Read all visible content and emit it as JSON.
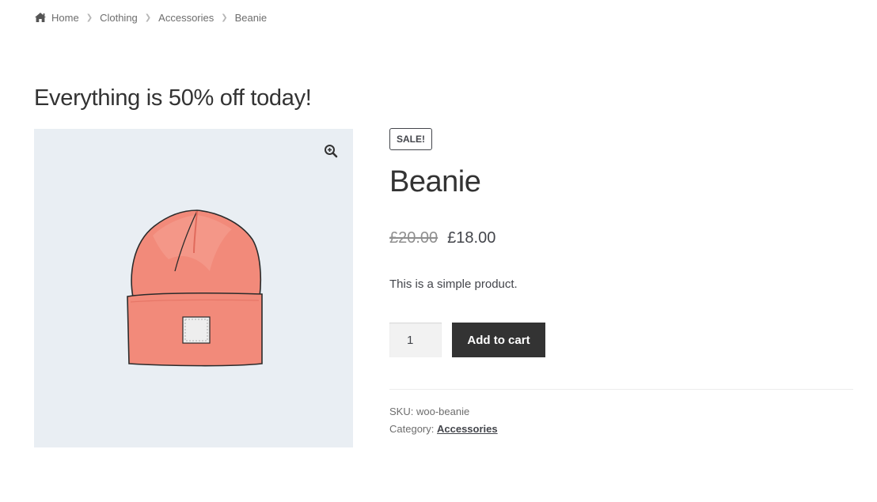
{
  "breadcrumb": {
    "home": "Home",
    "items": [
      "Clothing",
      "Accessories"
    ],
    "current": "Beanie"
  },
  "notice": {
    "text": "Everything is 50% off today!"
  },
  "gallery": {
    "zoom_icon": "zoom-in-icon",
    "background_color": "#e9eef3",
    "image": "beanie illustration"
  },
  "product": {
    "badge": "SALE!",
    "title": "Beanie",
    "price_old": "£20.00",
    "price_new": "£18.00",
    "short_description": "This is a simple product.",
    "quantity": "1",
    "add_to_cart_label": "Add to cart",
    "sku_label": "SKU:",
    "sku_value": "woo-beanie",
    "category_label": "Category:",
    "category_value": "Accessories"
  },
  "colors": {
    "button_bg": "#333333",
    "text": "#43454b",
    "beanie": "#f28a7a"
  }
}
